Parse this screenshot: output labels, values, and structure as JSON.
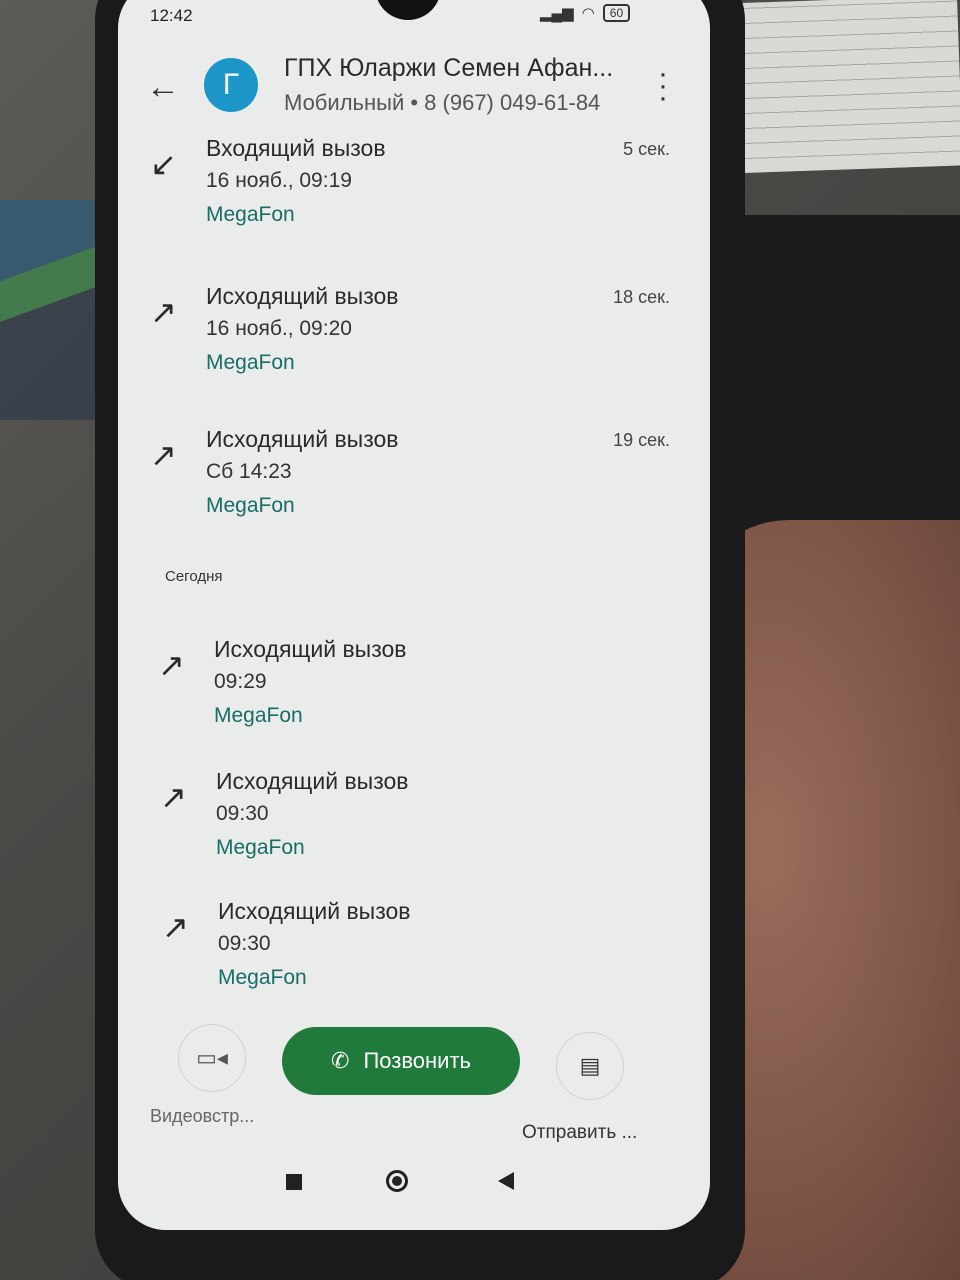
{
  "status_bar": {
    "time": "12:42",
    "battery": "60"
  },
  "contact": {
    "avatar_letter": "Г",
    "name": "ГПХ Юларжи Семен Афан...",
    "subtitle": "Мобильный • 8 (967) 049-61-84"
  },
  "calls": [
    {
      "icon": "incoming-call-icon",
      "type": "Входящий вызов",
      "time": "16 нояб., 09:19",
      "carrier": "MegaFon",
      "duration": "5 сек."
    },
    {
      "icon": "outgoing-call-icon",
      "type": "Исходящий вызов",
      "time": "16 нояб., 09:20",
      "carrier": "MegaFon",
      "duration": "18 сек."
    },
    {
      "icon": "outgoing-call-icon",
      "type": "Исходящий вызов",
      "time": "Сб 14:23",
      "carrier": "MegaFon",
      "duration": "19 сек."
    }
  ],
  "section_today": "Сегодня",
  "today_calls": [
    {
      "icon": "outgoing-call-icon",
      "type": "Исходящий вызов",
      "time": "09:29",
      "carrier": "MegaFon"
    },
    {
      "icon": "outgoing-call-icon",
      "type": "Исходящий вызов",
      "time": "09:30",
      "carrier": "MegaFon"
    },
    {
      "icon": "outgoing-call-icon",
      "type": "Исходящий вызов",
      "time": "09:30",
      "carrier": "MegaFon"
    }
  ],
  "actions": {
    "call_label": "Позвонить",
    "video_label": "Видеовстр...",
    "message_label": "Отправить ..."
  },
  "colors": {
    "accent_green": "#1f7a3c",
    "avatar_blue": "#1c96c8",
    "carrier_teal": "#1a6c66"
  }
}
